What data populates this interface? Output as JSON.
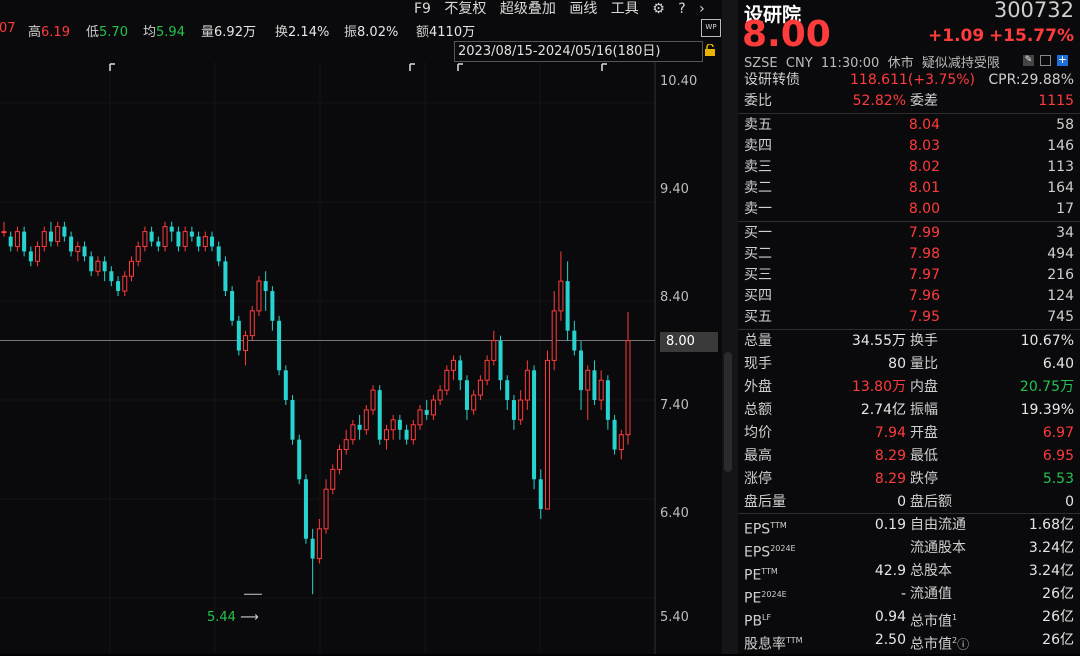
{
  "topbar": {
    "prev_fragment": "07",
    "high_label": "高",
    "high_value": "6.19",
    "low_label": "低",
    "low_value": "5.70",
    "avg_label": "均",
    "avg_value": "5.94",
    "vol_label": "量",
    "vol_value": "6.92万",
    "turnover_label": "换",
    "turnover_value": "2.14%",
    "amp_label": "振",
    "amp_value": "8.02%",
    "amount_label": "额",
    "amount_value": "4110万",
    "toolbar": {
      "f9": "F9",
      "adjust": "不复权",
      "overlay": "超级叠加",
      "draw": "画线",
      "tools": "工具"
    },
    "wp_label": "WP"
  },
  "range_label": "2023/08/15-2024/05/16(180日)",
  "price_ticks": [
    "10.40",
    "9.40",
    "8.40",
    "7.40",
    "6.40",
    "5.40"
  ],
  "current_price_tag": "8.00",
  "low_marker": "5.44",
  "quote": {
    "name": "设研院",
    "code": "300732",
    "price": "8.00",
    "change": "+1.09",
    "change_pct": "+15.77%",
    "meta": {
      "exchange": "SZSE",
      "currency": "CNY",
      "time": "11:30:00",
      "status": "休市",
      "note": "疑似减持受限"
    },
    "convertible": {
      "label": "设研转债",
      "value": "118.611(+3.75%)",
      "cpr_label": "CPR:",
      "cpr_value": "29.88%"
    },
    "bid_ratio": {
      "label": "委比",
      "value": "52.82%",
      "diff_label": "委差",
      "diff_value": "1115"
    },
    "asks": [
      {
        "label": "卖五",
        "price": "8.04",
        "vol": "58"
      },
      {
        "label": "卖四",
        "price": "8.03",
        "vol": "146"
      },
      {
        "label": "卖三",
        "price": "8.02",
        "vol": "113"
      },
      {
        "label": "卖二",
        "price": "8.01",
        "vol": "164"
      },
      {
        "label": "卖一",
        "price": "8.00",
        "vol": "17"
      }
    ],
    "bids": [
      {
        "label": "买一",
        "price": "7.99",
        "vol": "34"
      },
      {
        "label": "买二",
        "price": "7.98",
        "vol": "494"
      },
      {
        "label": "买三",
        "price": "7.97",
        "vol": "216"
      },
      {
        "label": "买四",
        "price": "7.96",
        "vol": "124"
      },
      {
        "label": "买五",
        "price": "7.95",
        "vol": "745"
      }
    ],
    "stats": [
      {
        "l1": "总量",
        "v1": "34.55万",
        "c1": "wht",
        "l2": "换手",
        "v2": "10.67%",
        "c2": "wht"
      },
      {
        "l1": "现手",
        "v1": "80",
        "c1": "wht",
        "l2": "量比",
        "v2": "6.40",
        "c2": "wht"
      },
      {
        "l1": "外盘",
        "v1": "13.80万",
        "c1": "up",
        "l2": "内盘",
        "v2": "20.75万",
        "c2": "down"
      },
      {
        "l1": "总额",
        "v1": "2.74亿",
        "c1": "wht",
        "l2": "振幅",
        "v2": "19.39%",
        "c2": "wht"
      },
      {
        "l1": "均价",
        "v1": "7.94",
        "c1": "up",
        "l2": "开盘",
        "v2": "6.97",
        "c2": "up"
      },
      {
        "l1": "最高",
        "v1": "8.29",
        "c1": "up",
        "l2": "最低",
        "v2": "6.95",
        "c2": "up"
      },
      {
        "l1": "涨停",
        "v1": "8.29",
        "c1": "up",
        "l2": "跌停",
        "v2": "5.53",
        "c2": "down"
      },
      {
        "l1": "盘后量",
        "v1": "0",
        "c1": "wht",
        "l2": "盘后额",
        "v2": "0",
        "c2": "wht"
      }
    ],
    "fundamentals": [
      {
        "l1": "EPS",
        "s1": "TTM",
        "v1": "0.19",
        "l2": "自由流通",
        "s2": "",
        "v2": "1.68亿"
      },
      {
        "l1": "EPS",
        "s1": "2024E",
        "v1": "",
        "l2": "流通股本",
        "s2": "",
        "v2": "3.24亿"
      },
      {
        "l1": "PE",
        "s1": "TTM",
        "v1": "42.9",
        "l2": "总股本",
        "s2": "",
        "v2": "3.24亿"
      },
      {
        "l1": "PE",
        "s1": "2024E",
        "v1": "-",
        "l2": "流通值",
        "s2": "",
        "v2": "26亿"
      },
      {
        "l1": "PB",
        "s1": "LF",
        "v1": "0.94",
        "l2": "总市值",
        "s2": "1",
        "v2": "26亿"
      },
      {
        "l1": "股息率",
        "s1": "TTM",
        "v1": "2.50",
        "l2": "总市值",
        "s2": "2",
        "v2": "26亿"
      }
    ]
  },
  "colors": {
    "up": "#ff3b3b",
    "down": "#27d3cf",
    "panel_bg": "#0a0a0c"
  },
  "chart_data": {
    "type": "candlestick",
    "ylim": [
      5.2,
      10.6
    ],
    "current": 8.0,
    "low_marker": 5.44,
    "candles": [
      [
        9.1,
        9.1,
        9.2,
        9.05
      ],
      [
        9.05,
        8.95,
        9.1,
        8.9
      ],
      [
        8.95,
        9.1,
        9.15,
        8.9
      ],
      [
        9.1,
        8.9,
        9.15,
        8.85
      ],
      [
        8.9,
        8.8,
        8.95,
        8.75
      ],
      [
        8.8,
        8.95,
        9.0,
        8.75
      ],
      [
        8.95,
        9.1,
        9.15,
        8.9
      ],
      [
        9.1,
        9.0,
        9.2,
        8.95
      ],
      [
        9.0,
        9.15,
        9.2,
        8.95
      ],
      [
        9.15,
        9.05,
        9.2,
        9.0
      ],
      [
        9.05,
        8.9,
        9.1,
        8.85
      ],
      [
        8.9,
        8.95,
        9.0,
        8.8
      ],
      [
        8.95,
        8.85,
        9.0,
        8.8
      ],
      [
        8.85,
        8.7,
        8.9,
        8.65
      ],
      [
        8.7,
        8.8,
        8.85,
        8.65
      ],
      [
        8.8,
        8.7,
        8.85,
        8.6
      ],
      [
        8.7,
        8.6,
        8.75,
        8.55
      ],
      [
        8.6,
        8.5,
        8.65,
        8.45
      ],
      [
        8.5,
        8.65,
        8.7,
        8.45
      ],
      [
        8.65,
        8.8,
        8.85,
        8.6
      ],
      [
        8.8,
        8.95,
        9.0,
        8.75
      ],
      [
        8.95,
        9.1,
        9.15,
        8.9
      ],
      [
        9.1,
        9.0,
        9.15,
        8.95
      ],
      [
        9.0,
        8.95,
        9.05,
        8.9
      ],
      [
        8.95,
        9.15,
        9.2,
        8.9
      ],
      [
        9.15,
        9.1,
        9.2,
        9.0
      ],
      [
        9.1,
        8.95,
        9.15,
        8.9
      ],
      [
        8.95,
        9.1,
        9.15,
        8.9
      ],
      [
        9.1,
        9.05,
        9.15,
        9.0
      ],
      [
        9.05,
        8.95,
        9.1,
        8.9
      ],
      [
        8.95,
        9.05,
        9.1,
        8.9
      ],
      [
        9.05,
        8.95,
        9.1,
        8.9
      ],
      [
        8.95,
        8.8,
        9.0,
        8.75
      ],
      [
        8.8,
        8.5,
        8.85,
        8.45
      ],
      [
        8.5,
        8.2,
        8.55,
        8.15
      ],
      [
        8.2,
        7.9,
        8.25,
        7.85
      ],
      [
        7.9,
        8.05,
        8.1,
        7.75
      ],
      [
        8.05,
        8.3,
        8.35,
        8.0
      ],
      [
        8.3,
        8.6,
        8.65,
        8.25
      ],
      [
        8.6,
        8.5,
        8.7,
        8.3
      ],
      [
        8.5,
        8.2,
        8.55,
        8.1
      ],
      [
        8.2,
        7.7,
        8.25,
        7.65
      ],
      [
        7.7,
        7.4,
        7.75,
        7.35
      ],
      [
        7.4,
        7.0,
        7.45,
        6.95
      ],
      [
        7.0,
        6.6,
        7.05,
        6.55
      ],
      [
        6.6,
        6.0,
        6.65,
        5.95
      ],
      [
        6.0,
        5.8,
        6.1,
        5.44
      ],
      [
        5.8,
        6.1,
        6.2,
        5.75
      ],
      [
        6.1,
        6.5,
        6.6,
        6.05
      ],
      [
        6.5,
        6.7,
        6.75,
        6.45
      ],
      [
        6.7,
        6.9,
        6.95,
        6.65
      ],
      [
        6.9,
        7.0,
        7.1,
        6.85
      ],
      [
        7.0,
        7.15,
        7.2,
        6.95
      ],
      [
        7.15,
        7.1,
        7.25,
        7.0
      ],
      [
        7.1,
        7.3,
        7.35,
        7.05
      ],
      [
        7.3,
        7.5,
        7.55,
        7.25
      ],
      [
        7.5,
        7.0,
        7.55,
        6.95
      ],
      [
        7.0,
        7.1,
        7.15,
        6.9
      ],
      [
        7.1,
        7.2,
        7.25,
        7.0
      ],
      [
        7.2,
        7.1,
        7.25,
        7.0
      ],
      [
        7.1,
        7.0,
        7.15,
        6.95
      ],
      [
        7.0,
        7.15,
        7.2,
        6.95
      ],
      [
        7.15,
        7.3,
        7.35,
        7.1
      ],
      [
        7.3,
        7.25,
        7.4,
        7.2
      ],
      [
        7.25,
        7.4,
        7.45,
        7.2
      ],
      [
        7.4,
        7.5,
        7.55,
        7.35
      ],
      [
        7.5,
        7.7,
        7.75,
        7.45
      ],
      [
        7.7,
        7.8,
        7.85,
        7.6
      ],
      [
        7.8,
        7.6,
        7.85,
        7.5
      ],
      [
        7.6,
        7.3,
        7.65,
        7.2
      ],
      [
        7.3,
        7.45,
        7.5,
        7.25
      ],
      [
        7.45,
        7.6,
        7.65,
        7.4
      ],
      [
        7.6,
        7.8,
        7.85,
        7.55
      ],
      [
        7.8,
        8.0,
        8.1,
        7.75
      ],
      [
        8.0,
        7.6,
        8.05,
        7.5
      ],
      [
        7.6,
        7.4,
        7.65,
        7.3
      ],
      [
        7.4,
        7.2,
        7.45,
        7.1
      ],
      [
        7.2,
        7.4,
        7.5,
        7.15
      ],
      [
        7.4,
        7.7,
        7.8,
        7.3
      ],
      [
        7.7,
        6.6,
        7.75,
        6.5
      ],
      [
        6.6,
        6.3,
        6.7,
        6.2
      ],
      [
        6.3,
        7.8,
        7.9,
        6.3
      ],
      [
        7.8,
        8.3,
        8.5,
        7.7
      ],
      [
        8.3,
        8.6,
        8.9,
        8.2
      ],
      [
        8.6,
        8.1,
        8.8,
        8.0
      ],
      [
        8.1,
        7.9,
        8.2,
        7.85
      ],
      [
        7.9,
        7.5,
        8.0,
        7.3
      ],
      [
        7.5,
        7.7,
        7.75,
        7.2
      ],
      [
        7.7,
        7.4,
        7.8,
        7.35
      ],
      [
        7.4,
        7.6,
        7.7,
        7.3
      ],
      [
        7.6,
        7.2,
        7.65,
        7.1
      ],
      [
        7.2,
        6.9,
        7.25,
        6.85
      ],
      [
        6.9,
        7.05,
        7.1,
        6.8
      ],
      [
        7.05,
        8.0,
        8.29,
        6.95
      ]
    ]
  }
}
